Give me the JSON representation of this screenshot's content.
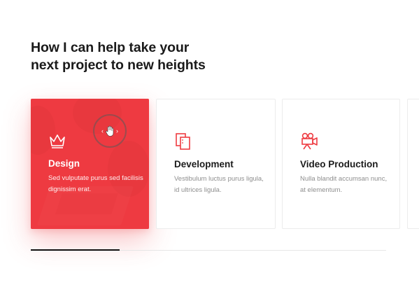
{
  "section": {
    "heading_line1": "How I can help take your",
    "heading_line2": "next project to new heights"
  },
  "services": [
    {
      "title": "Design",
      "description": "Sed vulputate purus sed facilisis dignissim erat.",
      "icon": "crown-icon",
      "active": true
    },
    {
      "title": "Development",
      "description": "Vestibulum luctus purus ligula, id ultrices ligula.",
      "icon": "layers-icon",
      "active": false
    },
    {
      "title": "Video Production",
      "description": "Nulla blandit accumsan nunc, at elementum.",
      "icon": "video-camera-icon",
      "active": false
    }
  ],
  "drag_cursor": {
    "left_arrow": "‹",
    "right_arrow": "›"
  },
  "slider": {
    "progress": 0.25
  },
  "colors": {
    "accent": "#ee3b41",
    "text": "#1a1a1a",
    "muted": "#8e8e8e",
    "track": "#e6e6e6"
  }
}
